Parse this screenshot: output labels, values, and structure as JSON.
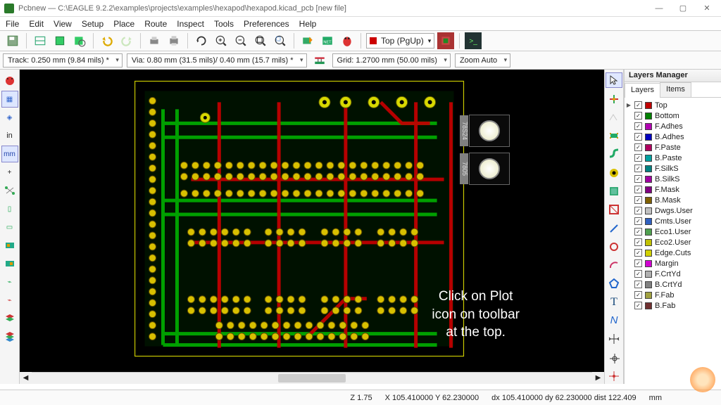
{
  "window": {
    "app": "Pcbnew",
    "path": "C:\\EAGLE 9.2.2\\examples\\projects\\examples\\hexapod\\hexapod.kicad_pcb [new file]"
  },
  "menu": {
    "items": [
      "File",
      "Edit",
      "View",
      "Setup",
      "Place",
      "Route",
      "Inspect",
      "Tools",
      "Preferences",
      "Help"
    ]
  },
  "toolbar_layer": {
    "label": "Top (PgUp)"
  },
  "secondbar": {
    "track": "Track: 0.250 mm (9.84 mils) *",
    "via": "Via: 0.80 mm (31.5 mils)/ 0.40 mm (15.7 mils) *",
    "grid": "Grid: 1.2700 mm (50.00 mils)",
    "zoom": "Zoom Auto"
  },
  "left_tools": {
    "labels": [
      "▦",
      "◈",
      "in",
      "mm",
      "+",
      "↕",
      "▯",
      "▭",
      "◧",
      "◨",
      "⌁",
      "⌁",
      "≡",
      "≣",
      "☷"
    ]
  },
  "overlay": {
    "line1": "Click on Plot",
    "line2": "icon on toolbar",
    "line3": "at the top."
  },
  "mech": {
    "a": "78S24",
    "b": "7805"
  },
  "layers_panel": {
    "title": "Layers Manager",
    "tabs": [
      "Layers",
      "Items"
    ],
    "layers": [
      {
        "name": "Top",
        "color": "#c00000",
        "checked": true,
        "active": true
      },
      {
        "name": "Bottom",
        "color": "#008000",
        "checked": true
      },
      {
        "name": "F.Adhes",
        "color": "#b000b0",
        "checked": true
      },
      {
        "name": "B.Adhes",
        "color": "#0000c0",
        "checked": true
      },
      {
        "name": "F.Paste",
        "color": "#b00060",
        "checked": true
      },
      {
        "name": "B.Paste",
        "color": "#00a0a0",
        "checked": true
      },
      {
        "name": "F.SilkS",
        "color": "#008080",
        "checked": true
      },
      {
        "name": "B.SilkS",
        "color": "#a000a0",
        "checked": true
      },
      {
        "name": "F.Mask",
        "color": "#800080",
        "checked": true
      },
      {
        "name": "B.Mask",
        "color": "#806000",
        "checked": true
      },
      {
        "name": "Dwgs.User",
        "color": "#c0c0c0",
        "checked": true
      },
      {
        "name": "Cmts.User",
        "color": "#3060c0",
        "checked": true
      },
      {
        "name": "Eco1.User",
        "color": "#50a050",
        "checked": true
      },
      {
        "name": "Eco2.User",
        "color": "#c0c000",
        "checked": true
      },
      {
        "name": "Edge.Cuts",
        "color": "#d0d000",
        "checked": true
      },
      {
        "name": "Margin",
        "color": "#d000d0",
        "checked": true
      },
      {
        "name": "F.CrtYd",
        "color": "#b0b0b0",
        "checked": true
      },
      {
        "name": "B.CrtYd",
        "color": "#808080",
        "checked": true
      },
      {
        "name": "F.Fab",
        "color": "#a0a040",
        "checked": true
      },
      {
        "name": "B.Fab",
        "color": "#703030",
        "checked": true
      }
    ]
  },
  "status": {
    "z": "Z 1.75",
    "xy": "X 105.410000  Y 62.230000",
    "dxy": "dx 105.410000  dy 62.230000  dist 122.409",
    "units": "mm"
  }
}
